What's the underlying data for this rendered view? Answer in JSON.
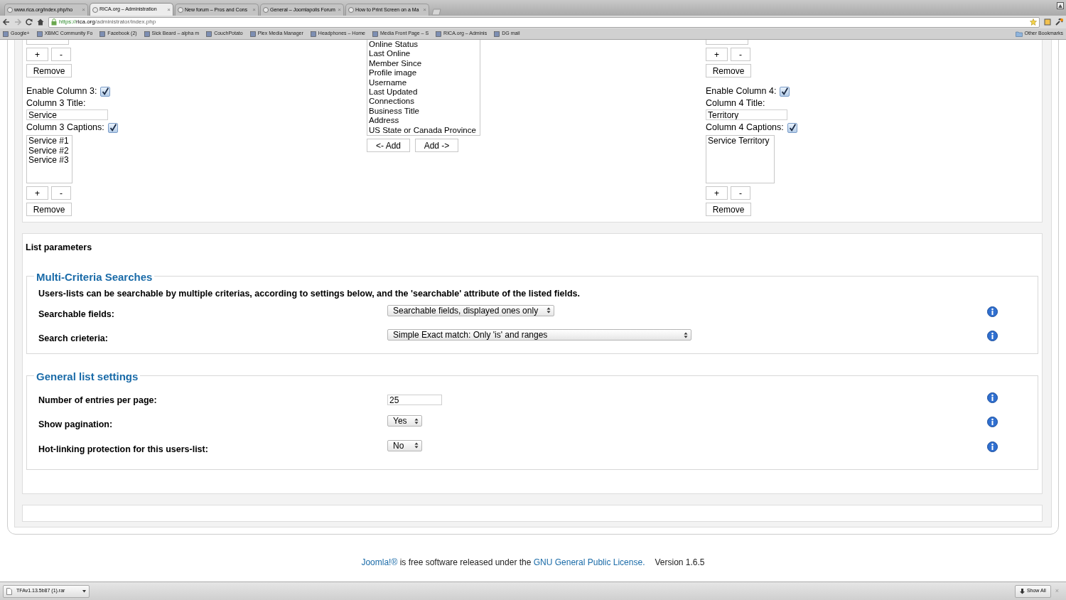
{
  "tabs": [
    {
      "label": "www.rica.org/index.php/ho",
      "close": "×",
      "selected": false
    },
    {
      "label": "RICA.org – Administration",
      "close": "×",
      "selected": true
    },
    {
      "label": "New forum – Pros and Cons",
      "close": "×",
      "selected": false
    },
    {
      "label": "General – Joomlapolis Forum",
      "close": "×",
      "selected": false
    },
    {
      "label": "How to Print Screen on a Ma",
      "close": "×",
      "selected": false
    }
  ],
  "address": {
    "secure": "https://",
    "host": "rica.org",
    "path": "/administrator/index.php"
  },
  "bookmarks": [
    "Google+",
    "XBMC Community Fo",
    "Facebook (2)",
    "Sick Beard – alpha m",
    "CouchPotato",
    "Plex Media Manager",
    "Headphones – Home",
    "Media Front Page – S",
    "RICA.org – Adminis",
    "DG mail"
  ],
  "other_bookmarks": "Other Bookmarks",
  "columns": [
    {
      "plus": "+",
      "minus": "-",
      "remove": "Remove",
      "enable_label": "Enable Column 3:",
      "enabled": true,
      "title_label": "Column 3 Title:",
      "title_value": "Service",
      "captions_label": "Column 3 Captions:",
      "captions": true,
      "caption_items": [
        "Service #1",
        "Service #2",
        "Service #3"
      ],
      "plus2": "+",
      "minus2": "-",
      "remove2": "Remove"
    },
    {
      "plus": "+",
      "minus": "-",
      "remove": "Remove",
      "enable_label": "Enable Column 4:",
      "enabled": true,
      "title_label": "Column 4 Title:",
      "title_value": "Territory",
      "captions_label": "Column 4 Captions:",
      "captions": true,
      "caption_items": [
        "Service Territory"
      ],
      "plus2": "+",
      "minus2": "-",
      "remove2": "Remove"
    }
  ],
  "field_list": {
    "items": [
      "Online Status",
      "Last Online",
      "Member Since",
      "Profile image",
      "Username",
      "Last Updated",
      "Connections",
      "Business Title",
      "Address",
      "US State or Canada Province"
    ],
    "add_left": "<- Add",
    "add_right": "Add ->"
  },
  "list_parameters": {
    "title": "List parameters",
    "sections": [
      {
        "legend": "Multi-Criteria Searches",
        "description": "Users-lists can be searchable by multiple criterias, according to settings below, and the 'searchable' attribute of the listed fields.",
        "rows": [
          {
            "label": "Searchable fields:",
            "kind": "select",
            "value": "Searchable fields, displayed ones only"
          },
          {
            "label": "Search crieteria:",
            "kind": "select",
            "value": "Simple Exact match: Only 'is' and ranges"
          }
        ]
      },
      {
        "legend": "General list settings",
        "rows": [
          {
            "label": "Number of entries per page:",
            "kind": "text",
            "value": "25"
          },
          {
            "label": "Show pagination:",
            "kind": "select",
            "value": "Yes"
          },
          {
            "label": "Hot-linking protection for this users-list:",
            "kind": "select",
            "value": "No"
          }
        ]
      }
    ]
  },
  "footer": {
    "link1": "Joomla!®",
    "text": "is free software released under the",
    "link2": "GNU General Public License.",
    "version": "Version 1.6.5"
  },
  "download": {
    "file": "TFAv1.13.5b87 (1).rar",
    "show_all": "Show All",
    "close": "×"
  }
}
